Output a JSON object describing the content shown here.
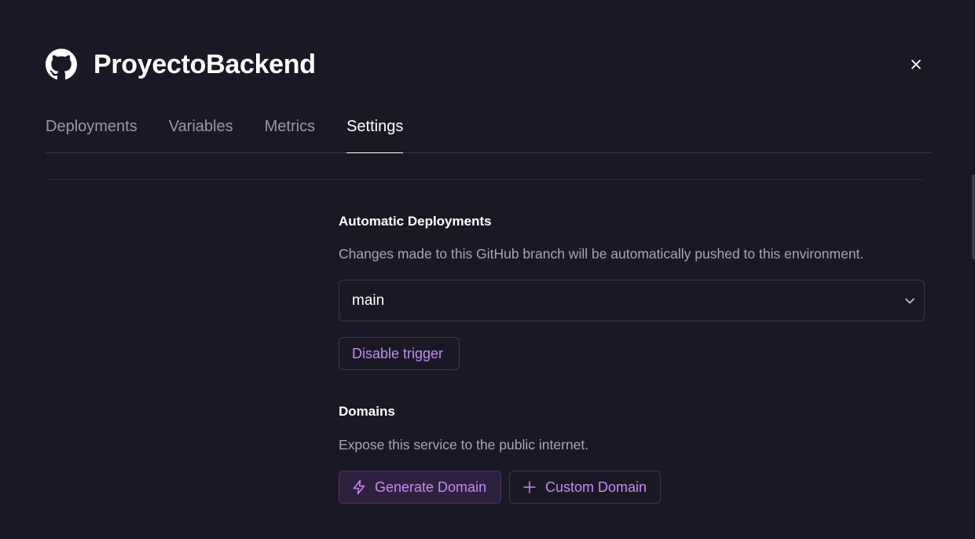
{
  "header": {
    "title": "ProyectoBackend",
    "icon": "github-icon"
  },
  "close": {
    "icon": "close-icon"
  },
  "tabs": [
    {
      "label": "Deployments",
      "active": false
    },
    {
      "label": "Variables",
      "active": false
    },
    {
      "label": "Metrics",
      "active": false
    },
    {
      "label": "Settings",
      "active": true
    }
  ],
  "automatic_deployments": {
    "title": "Automatic Deployments",
    "description": "Changes made to this GitHub branch will be automatically pushed to this environment.",
    "branch_select": {
      "value": "main",
      "icon": "chevron-down-icon"
    },
    "disable_button_label": "Disable trigger"
  },
  "domains": {
    "title": "Domains",
    "description": "Expose this service to the public internet.",
    "generate_button": {
      "label": "Generate Domain",
      "icon": "lightning-icon"
    },
    "custom_button": {
      "label": "Custom Domain",
      "icon": "plus-icon"
    }
  },
  "colors": {
    "background": "#1b1825",
    "accent": "#c48cf5",
    "muted_text": "#a9a6b3",
    "border": "#3a3646"
  }
}
